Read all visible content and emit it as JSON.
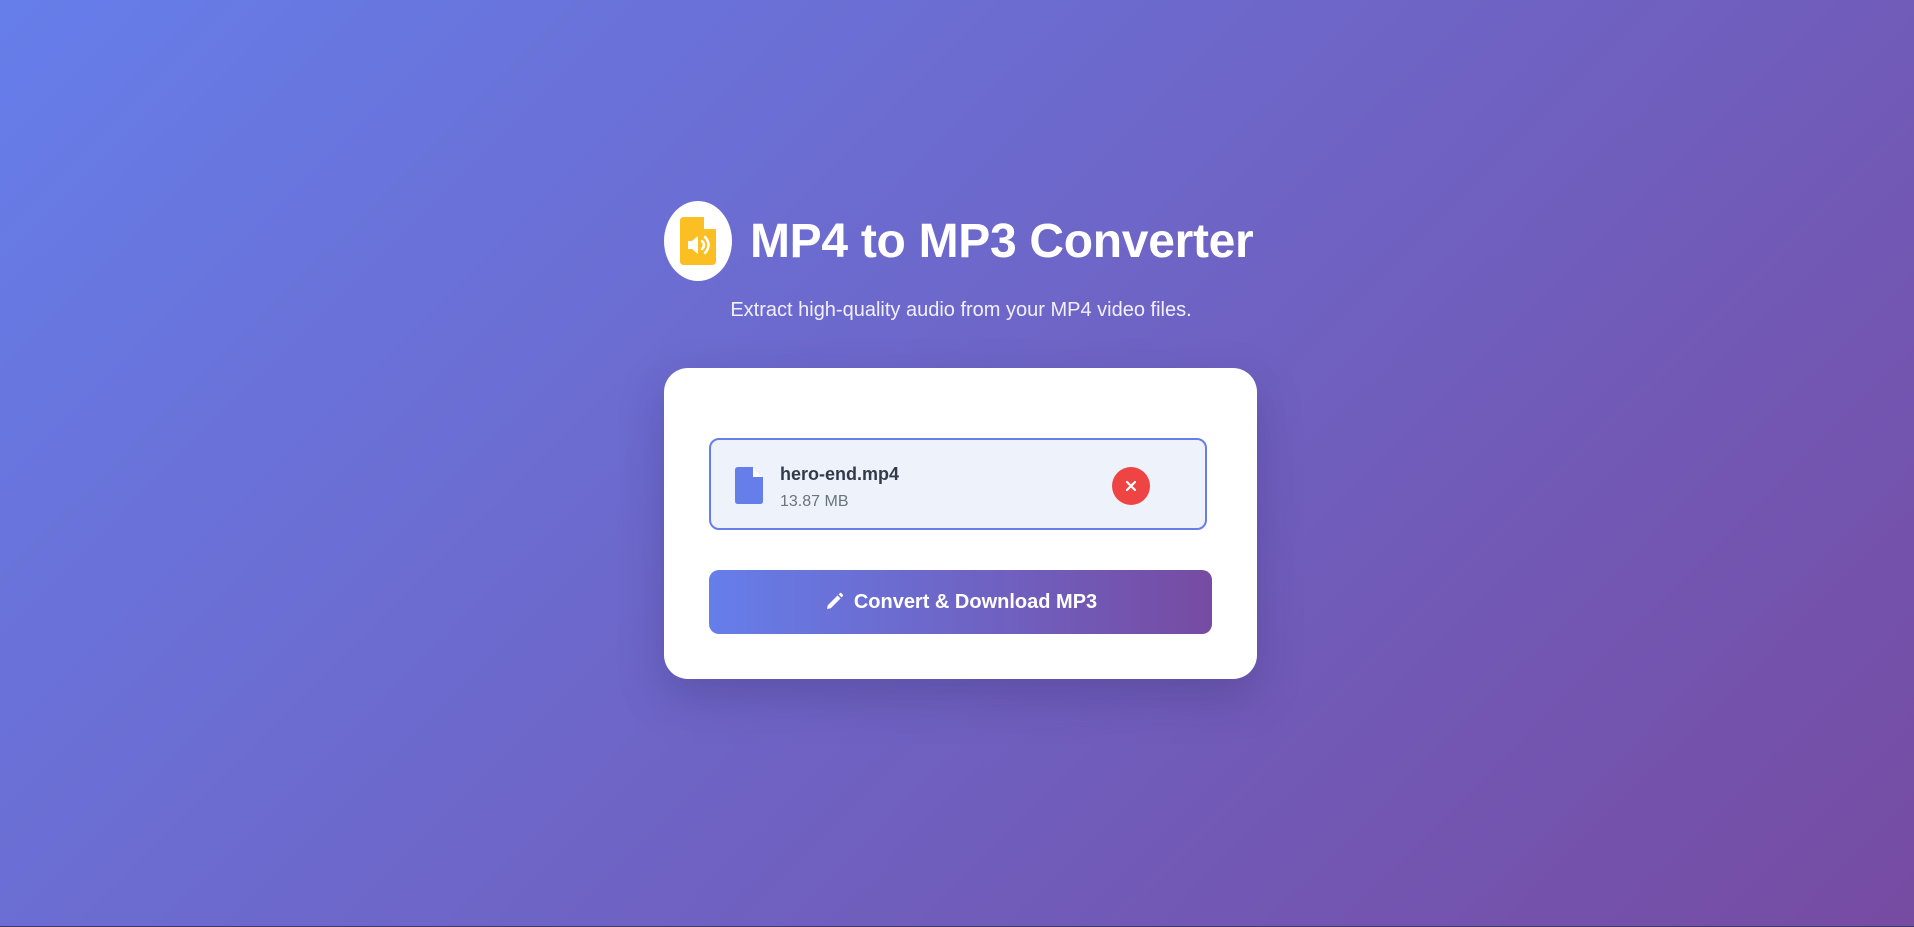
{
  "header": {
    "title": "MP4 to MP3 Converter",
    "subtitle": "Extract high-quality audio from your MP4 video files.",
    "logo_icon": "file-audio-icon"
  },
  "upload": {
    "file_name": "hero-end.mp4",
    "file_size": "13.87 MB",
    "file_icon": "file-icon",
    "remove_icon": "close-icon"
  },
  "actions": {
    "convert_label": "Convert & Download MP3",
    "convert_icon": "pencil-icon"
  },
  "colors": {
    "gradient_start": "#667eea",
    "gradient_end": "#764ba2",
    "logo_accent": "#fbbf24",
    "remove_button": "#ef4444",
    "file_row_background": "#eef2fb"
  }
}
